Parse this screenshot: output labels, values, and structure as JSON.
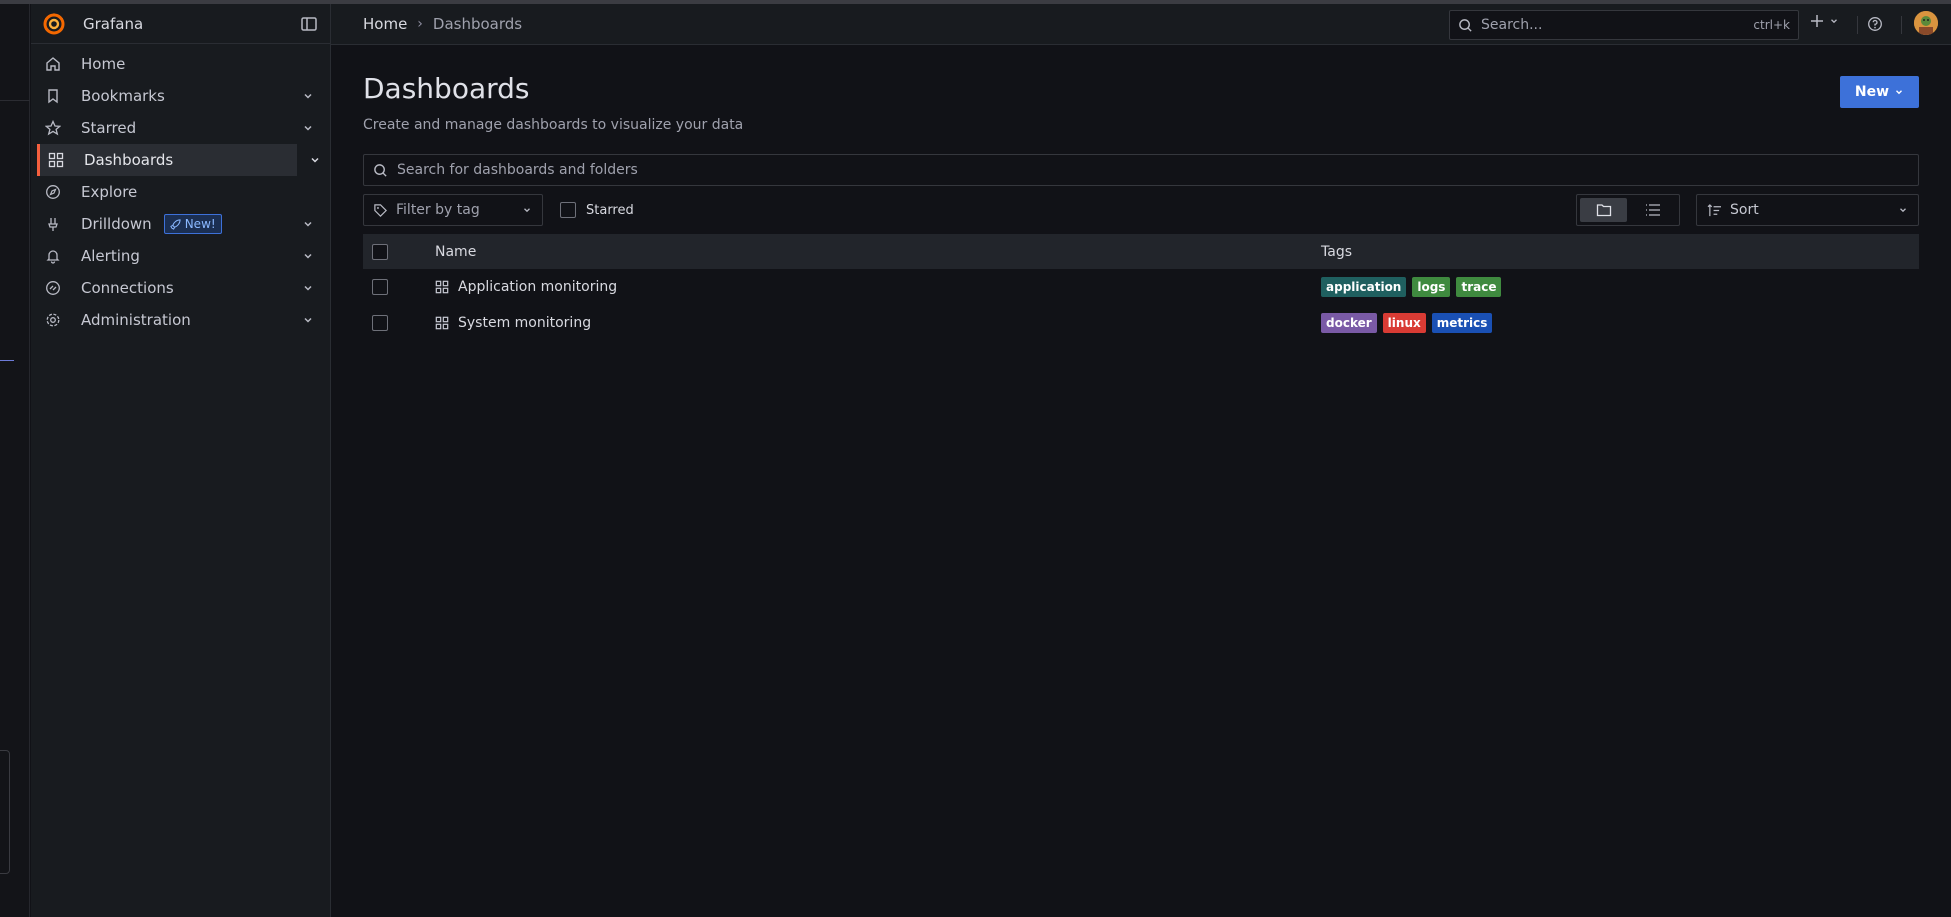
{
  "app": {
    "name": "Grafana"
  },
  "nav": {
    "items": [
      {
        "label": "Home",
        "icon": "home-icon",
        "expandable": false
      },
      {
        "label": "Bookmarks",
        "icon": "bookmark-icon",
        "expandable": true
      },
      {
        "label": "Starred",
        "icon": "star-icon",
        "expandable": true
      },
      {
        "label": "Dashboards",
        "icon": "apps-icon",
        "expandable": true,
        "active": true
      },
      {
        "label": "Explore",
        "icon": "compass-icon",
        "expandable": false
      },
      {
        "label": "Drilldown",
        "icon": "drilldown-icon",
        "expandable": true,
        "badge": "New!"
      },
      {
        "label": "Alerting",
        "icon": "bell-icon",
        "expandable": true
      },
      {
        "label": "Connections",
        "icon": "connections-icon",
        "expandable": true
      },
      {
        "label": "Administration",
        "icon": "gear-icon",
        "expandable": true
      }
    ]
  },
  "topbar": {
    "breadcrumbs": {
      "home": "Home",
      "separator": "›",
      "current": "Dashboards"
    },
    "search": {
      "placeholder": "Search...",
      "shortcut": "ctrl+k"
    }
  },
  "page": {
    "title": "Dashboards",
    "subtitle": "Create and manage dashboards to visualize your data",
    "new_button": "New",
    "search_placeholder": "Search for dashboards and folders",
    "tag_filter_placeholder": "Filter by tag",
    "starred_label": "Starred",
    "sort_label": "Sort"
  },
  "table": {
    "headers": {
      "name": "Name",
      "tags": "Tags"
    },
    "rows": [
      {
        "name": "Application monitoring",
        "tags": [
          {
            "label": "application",
            "color": "#1f5f5f"
          },
          {
            "label": "logs",
            "color": "#3f8a3f"
          },
          {
            "label": "trace",
            "color": "#3f8a3f"
          }
        ]
      },
      {
        "name": "System monitoring",
        "tags": [
          {
            "label": "docker",
            "color": "#7a5aa6"
          },
          {
            "label": "linux",
            "color": "#d93b34"
          },
          {
            "label": "metrics",
            "color": "#1a50b4"
          }
        ]
      }
    ]
  },
  "colors": {
    "accent": "#3d71d9",
    "active_indicator": "#f55f3e",
    "background": "#111217",
    "panel": "#181b1f"
  }
}
